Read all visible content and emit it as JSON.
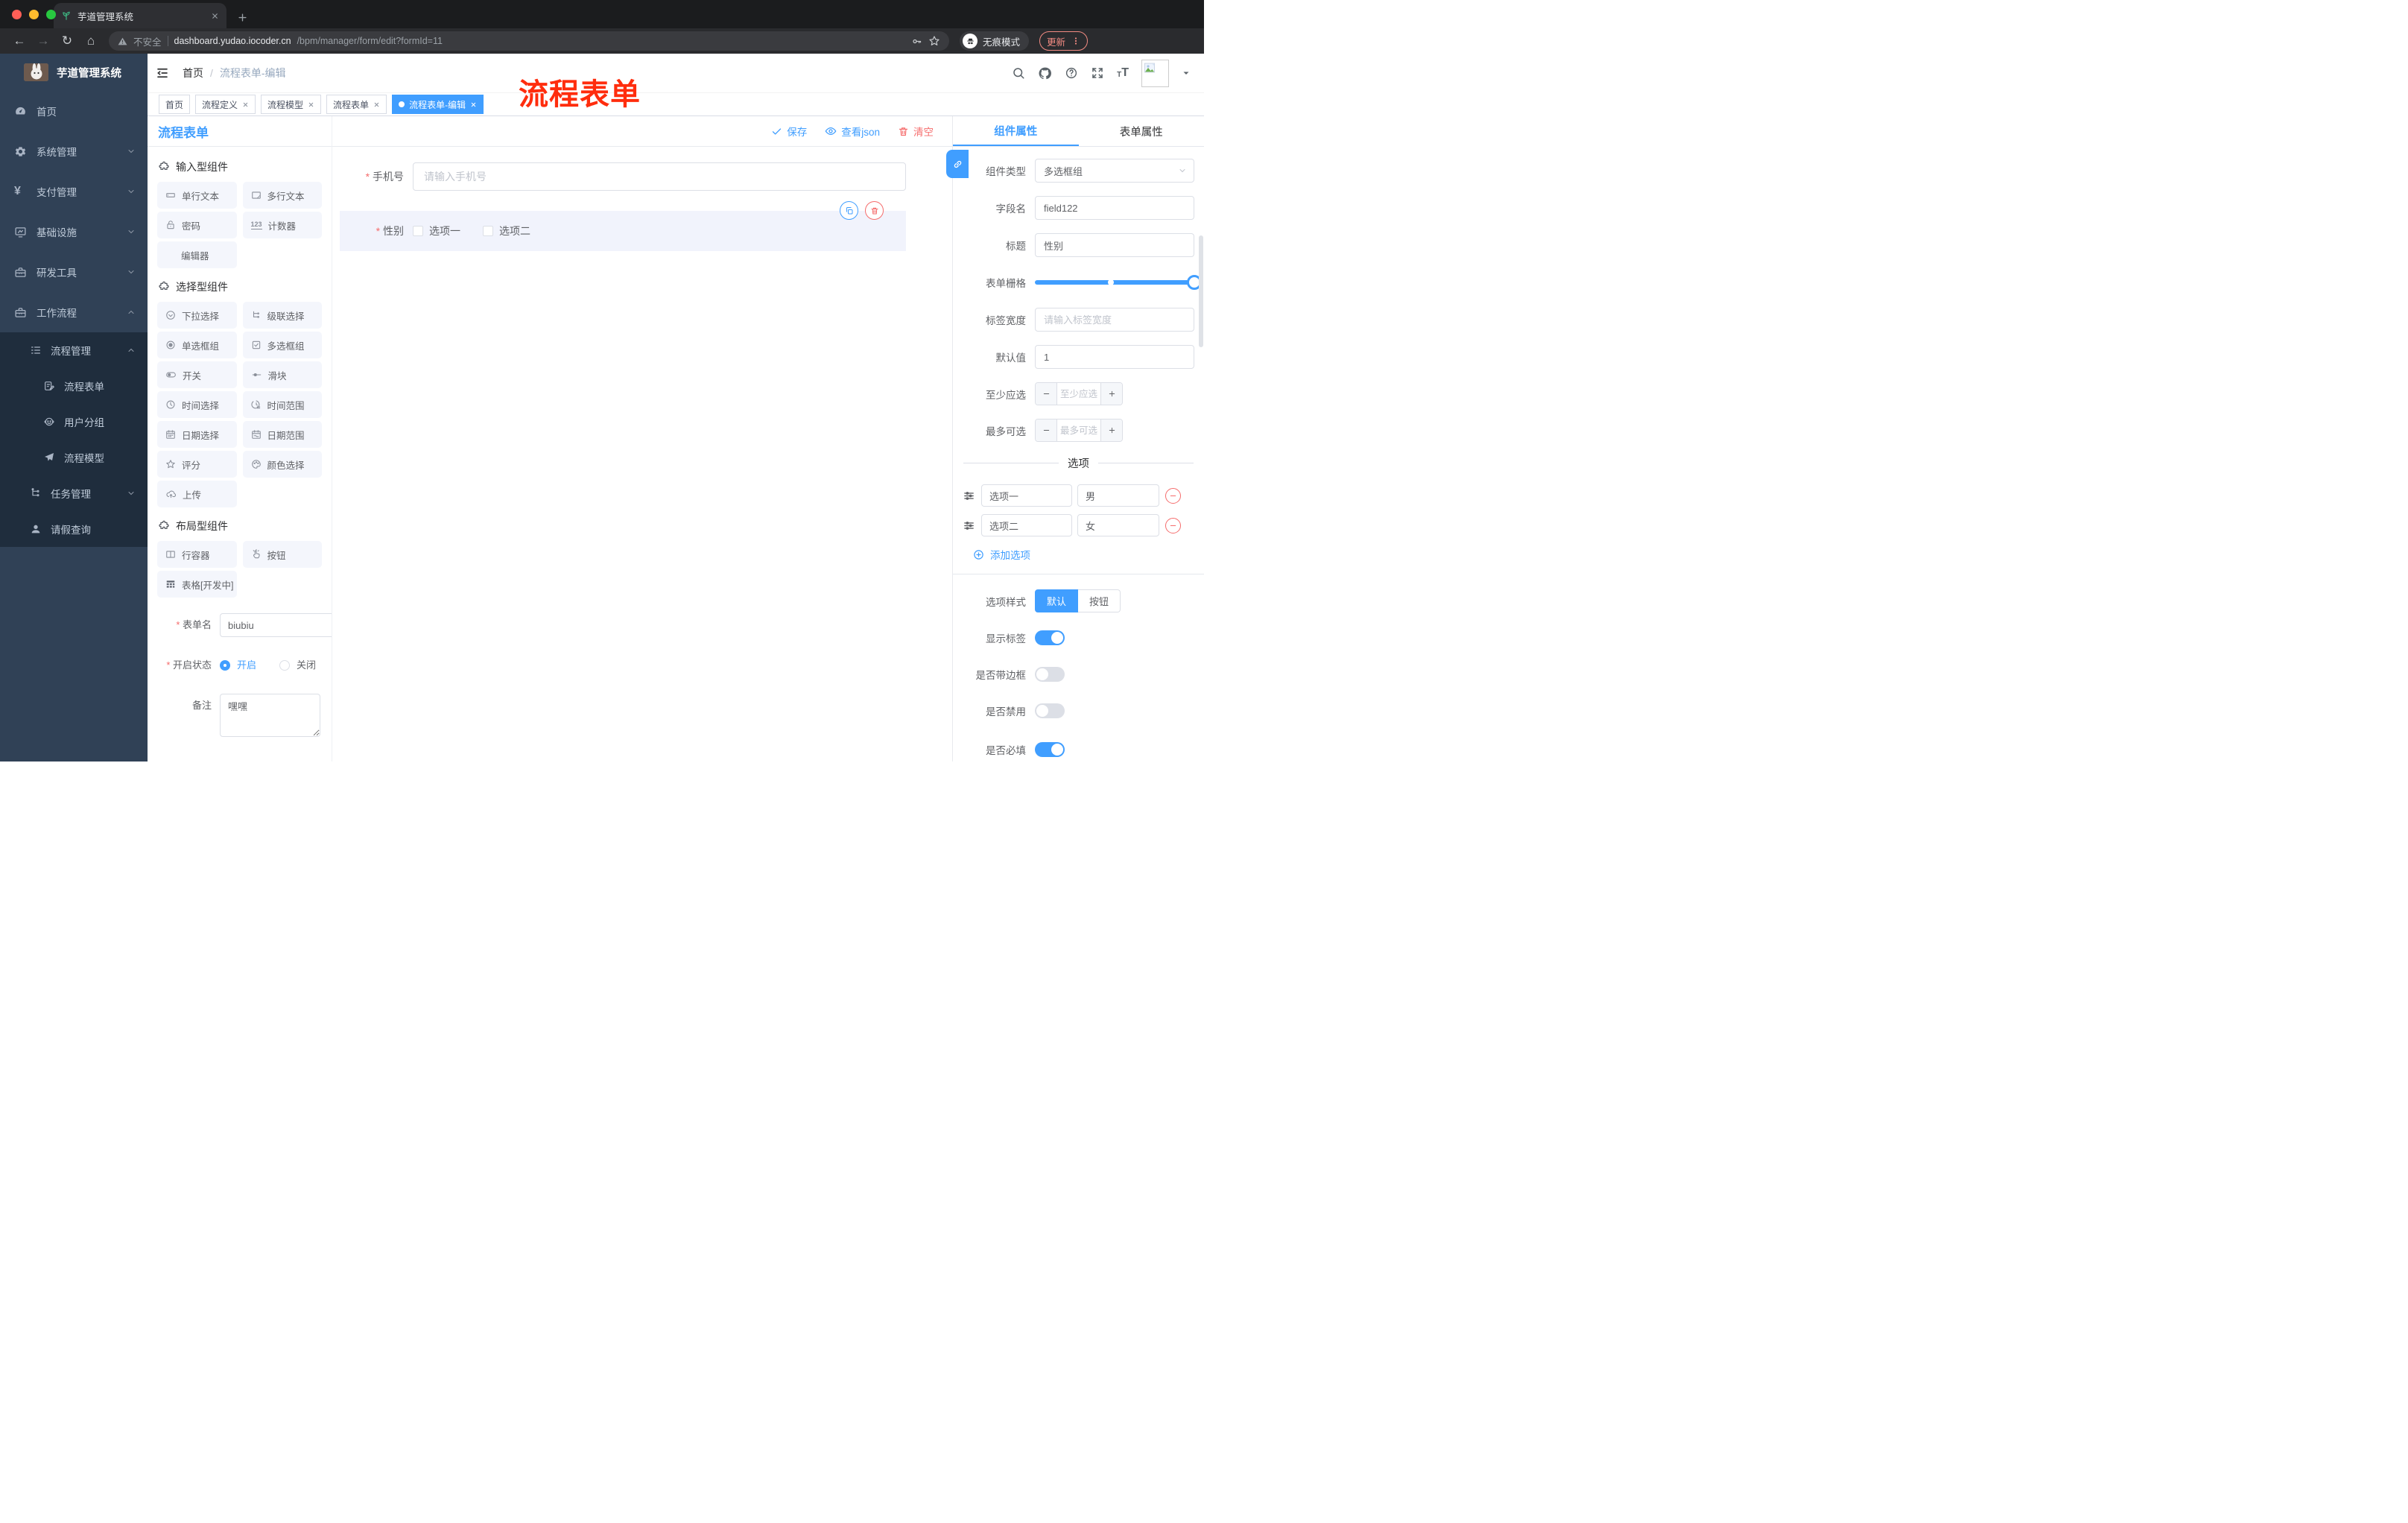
{
  "browser": {
    "tab_title": "芋道管理系统",
    "security_label": "不安全",
    "url_domain": "dashboard.yudao.iocoder.cn",
    "url_path": "/bpm/manager/form/edit?formId=11",
    "incognito_label": "无痕模式",
    "update_label": "更新"
  },
  "annotation": {
    "overlay_text": "流程表单"
  },
  "sidebar": {
    "logo_title": "芋道管理系统",
    "items": [
      {
        "label": "首页"
      },
      {
        "label": "系统管理"
      },
      {
        "label": "支付管理"
      },
      {
        "label": "基础设施"
      },
      {
        "label": "研发工具"
      },
      {
        "label": "工作流程"
      }
    ],
    "workflow_children": [
      {
        "label": "流程管理"
      },
      {
        "label": "流程表单"
      },
      {
        "label": "用户分组"
      },
      {
        "label": "流程模型"
      },
      {
        "label": "任务管理"
      },
      {
        "label": "请假查询"
      }
    ]
  },
  "header": {
    "breadcrumb_home": "首页",
    "breadcrumb_current": "流程表单-编辑"
  },
  "tags": [
    {
      "label": "首页"
    },
    {
      "label": "流程定义"
    },
    {
      "label": "流程模型"
    },
    {
      "label": "流程表单"
    },
    {
      "label": "流程表单-编辑"
    }
  ],
  "designer": {
    "title": "流程表单",
    "save_label": "保存",
    "view_json_label": "查看json",
    "clear_label": "清空"
  },
  "library": {
    "groups": [
      {
        "title": "输入型组件",
        "items": [
          "单行文本",
          "多行文本",
          "密码",
          "计数器",
          "编辑器"
        ]
      },
      {
        "title": "选择型组件",
        "items": [
          "下拉选择",
          "级联选择",
          "单选框组",
          "多选框组",
          "开关",
          "滑块",
          "时间选择",
          "时间范围",
          "日期选择",
          "日期范围",
          "评分",
          "颜色选择",
          "上传"
        ]
      },
      {
        "title": "布局型组件",
        "items": [
          "行容器",
          "按钮",
          "表格[开发中]"
        ]
      }
    ]
  },
  "meta_form": {
    "name_label": "表单名",
    "name_value": "biubiu",
    "status_label": "开启状态",
    "status_on": "开启",
    "status_off": "关闭",
    "remark_label": "备注",
    "remark_value": "嘿嘿"
  },
  "canvas": {
    "phone_label": "手机号",
    "phone_placeholder": "请输入手机号",
    "gender_label": "性别",
    "gender_option1": "选项一",
    "gender_option2": "选项二"
  },
  "props": {
    "tab_component": "组件属性",
    "tab_form": "表单属性",
    "type_label": "组件类型",
    "type_value": "多选框组",
    "field_label": "字段名",
    "field_value": "field122",
    "title_label": "标题",
    "title_value": "性别",
    "grid_label": "表单栅格",
    "label_width_label": "标签宽度",
    "label_width_placeholder": "请输入标签宽度",
    "default_label": "默认值",
    "default_value": "1",
    "min_label": "至少应选",
    "min_placeholder": "至少应选",
    "max_label": "最多可选",
    "max_placeholder": "最多可选",
    "options_title": "选项",
    "options": [
      {
        "label": "选项一",
        "value": "男"
      },
      {
        "label": "选项二",
        "value": "女"
      }
    ],
    "add_option_label": "添加选项",
    "style_label": "选项样式",
    "style_default": "默认",
    "style_button": "按钮",
    "show_label_label": "显示标签",
    "border_label": "是否带边框",
    "disabled_label": "是否禁用",
    "required_label": "是否必填"
  },
  "colors": {
    "accent": "#409EFF",
    "danger": "#F56C6C",
    "sidebar_bg": "#304156",
    "submenu_bg": "#1F2D3D",
    "annotation": "#FF2D0D"
  }
}
